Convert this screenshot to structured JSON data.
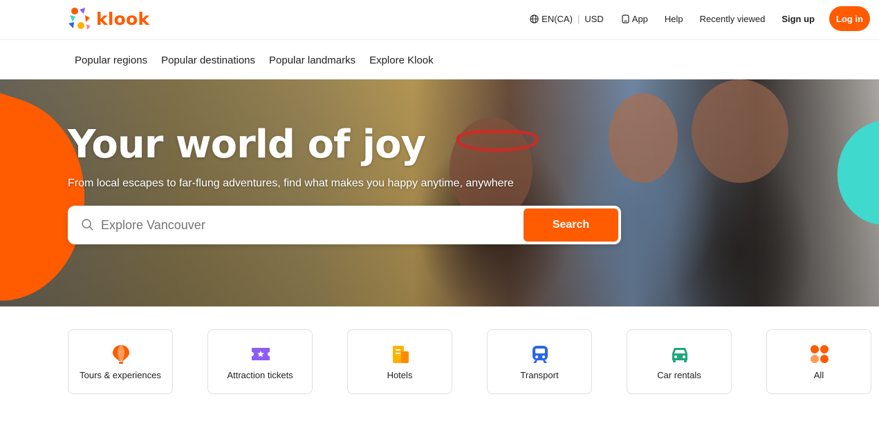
{
  "header": {
    "brand": "klook",
    "language": "EN(CA)",
    "currency": "USD",
    "app_label": "App",
    "help_label": "Help",
    "recently_viewed_label": "Recently viewed",
    "signup_label": "Sign up",
    "login_label": "Log in",
    "brand_color": "#ff5b00"
  },
  "subnav": {
    "items": [
      "Popular regions",
      "Popular destinations",
      "Popular landmarks",
      "Explore Klook"
    ]
  },
  "hero": {
    "title": "Your world of joy",
    "subtitle": "From local escapes to far-flung adventures, find what makes you happy anytime, anywhere",
    "search_placeholder": "Explore Vancouver",
    "search_button": "Search"
  },
  "categories": [
    {
      "label": "Tours & experiences",
      "icon": "hot-air-balloon-icon"
    },
    {
      "label": "Attraction tickets",
      "icon": "ticket-icon"
    },
    {
      "label": "Hotels",
      "icon": "hotel-icon"
    },
    {
      "label": "Transport",
      "icon": "train-icon"
    },
    {
      "label": "Car rentals",
      "icon": "car-icon"
    },
    {
      "label": "All",
      "icon": "grid-icon"
    }
  ]
}
